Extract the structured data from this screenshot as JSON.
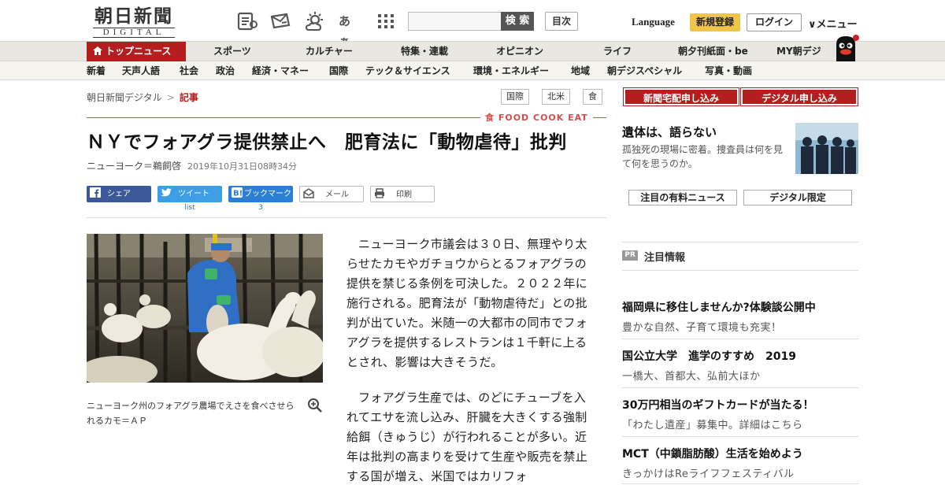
{
  "header": {
    "logo_main": "朝日新聞",
    "logo_sub": "DIGITAL",
    "icons": [
      "newspaper-icon",
      "mail-ticket-icon",
      "weather-icon",
      "font-size-icon",
      "grid-menu-icon"
    ],
    "font_icon_text": "あぁ",
    "search_placeholder": "",
    "search_label": "検 索",
    "mokuji": "目次",
    "language": "Language",
    "register": "新規登録",
    "login": "ログイン",
    "menu": "∨メニュー"
  },
  "nav1": {
    "top": "トップニュース",
    "items": [
      "スポーツ",
      "カルチャー",
      "特集・連載",
      "オピニオン",
      "ライフ",
      "朝夕刊紙面・be",
      "MY朝デジ"
    ]
  },
  "nav2": {
    "items": [
      "新着",
      "天声人語",
      "社会",
      "政治",
      "経済・マネー",
      "国際",
      "テック＆サイエンス",
      "環境・エネルギー",
      "地域",
      "朝デジスペシャル",
      "写真・動画"
    ]
  },
  "breadcrumb": {
    "home": "朝日新聞デジタル",
    "sep": ">",
    "current": "記事"
  },
  "tags": [
    "国際",
    "北米",
    "食"
  ],
  "section_label": "食 FOOD COOK EAT",
  "article": {
    "headline": "ＮＹでフォアグラ提供禁止へ　肥育法に「動物虐待」批判",
    "byline": "ニューヨーク＝鵜飼啓",
    "date": "2019年10月31日08時34分",
    "caption": "ニューヨーク州のフォアグラ農場でえさを食べさせられるカモ＝ＡＰ",
    "paragraphs": [
      "ニューヨーク市議会は３０日、無理やり太らせたカモやガチョウからとるフォアグラの提供を禁じる条例を可決した。２０２２年に施行される。肥育法が「動物虐待だ」との批判が出ていた。米随一の大都市の同市でフォアグラを提供するレストランは１千軒に上るとされ、影響は大きそうだ。",
      "フォアグラ生産では、のどにチューブを入れてエサを流し込み、肝臓を大きくする強制給餌（きゅうじ）が行われることが多い。近年は批判の高まりを受けて生産や販売を禁止する国が増え、米国ではカリフォ"
    ]
  },
  "share": {
    "facebook": "シェア",
    "twitter": "ツイート",
    "twitter_count": "list",
    "hatena": "ブックマーク",
    "hatena_count": "3",
    "mail": "メール",
    "print": "印刷"
  },
  "sidebar": {
    "btn_delivery": "新聞宅配申し込み",
    "btn_digital": "デジタル申し込み",
    "promo_title": "遺体は、語らない",
    "promo_text": "孤独死の現場に密着。捜査員は何を見て何を思うのか。",
    "tab_paid": "注目の有料ニュース",
    "tab_digital": "デジタル限定",
    "pr_badge": "PR",
    "pr_heading": "注目情報",
    "pr_items": [
      {
        "title": "福岡県に移住しませんか?体験談公開中",
        "sub": "豊かな自然、子育て環境も充実！"
      },
      {
        "title": "国公立大学　進学のすすめ　2019",
        "sub": "一橋大、首都大、弘前大ほか"
      },
      {
        "title": "30万円相当のギフトカードが当たる！",
        "sub": "「わたし遺産」募集中。詳細はこちら"
      },
      {
        "title": "MCT（中鎖脂肪酸）生活を始めよう",
        "sub": "きっかけはReライフフェスティバル"
      }
    ]
  },
  "colors": {
    "brand_red": "#b51e1e",
    "register_yellow": "#f0c64a",
    "facebook": "#3b5998",
    "twitter": "#3d9ee4",
    "hatena": "#2a7fd4"
  }
}
